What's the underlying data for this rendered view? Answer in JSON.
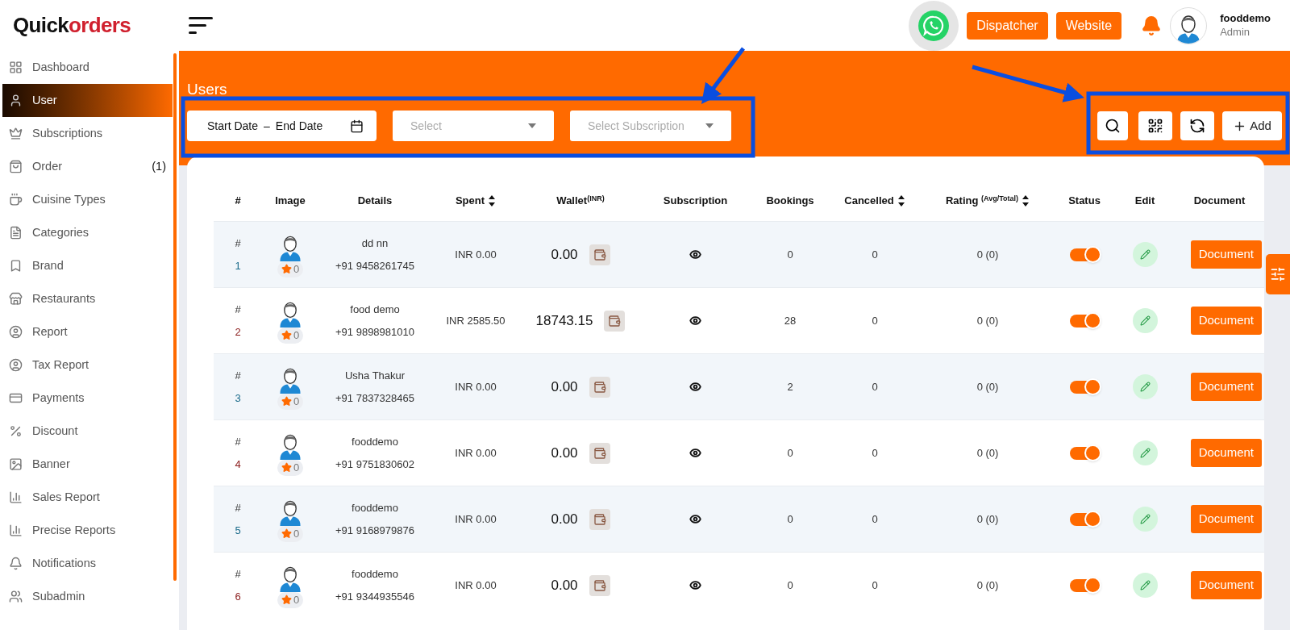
{
  "logo": {
    "part_1": "Quick",
    "part_2": "orders"
  },
  "sidebar": {
    "items": [
      {
        "label": "Dashboard",
        "selected": false
      },
      {
        "label": "User",
        "selected": true
      },
      {
        "label": "Subscriptions",
        "selected": false
      },
      {
        "label": "Order",
        "selected": false,
        "count": "(1)"
      },
      {
        "label": "Cuisine Types",
        "selected": false
      },
      {
        "label": "Categories",
        "selected": false
      },
      {
        "label": "Brand",
        "selected": false
      },
      {
        "label": "Restaurants",
        "selected": false
      },
      {
        "label": "Report",
        "selected": false
      },
      {
        "label": "Tax Report",
        "selected": false
      },
      {
        "label": "Payments",
        "selected": false
      },
      {
        "label": "Discount",
        "selected": false
      },
      {
        "label": "Banner",
        "selected": false
      },
      {
        "label": "Sales Report",
        "selected": false
      },
      {
        "label": "Precise Reports",
        "selected": false
      },
      {
        "label": "Notifications",
        "selected": false
      },
      {
        "label": "Subadmin",
        "selected": false
      }
    ]
  },
  "header": {
    "buttons": [
      "Dispatcher",
      "Website"
    ],
    "user": {
      "name": "fooddemo",
      "role": "Admin"
    }
  },
  "page": {
    "title": "Users",
    "filters": {
      "date_start": "Start Date",
      "date_separator": "–",
      "date_end": "End Date",
      "select_placeholder": "Select",
      "subscription_placeholder": "Select Subscription"
    },
    "add_button": "Add"
  },
  "table": {
    "columns": [
      {
        "label": "#",
        "sortable": false
      },
      {
        "label": "Image",
        "sortable": false
      },
      {
        "label": "Details",
        "sortable": false
      },
      {
        "label": "Spent",
        "sortable": true
      },
      {
        "label": "Wallet$^{(INR)}$",
        "sortable": false
      },
      {
        "label": "Subscription",
        "sortable": false
      },
      {
        "label": "Bookings",
        "sortable": false
      },
      {
        "label": "Cancelled",
        "sortable": true
      },
      {
        "label": "Rating $^{(Avg/Total)}$",
        "sortable": true
      },
      {
        "label": "Status",
        "sortable": false
      },
      {
        "label": "Edit",
        "sortable": false
      },
      {
        "label": "Document",
        "sortable": false
      }
    ],
    "rows": [
      {
        "hash": "#",
        "index": "1",
        "rating_count": "0",
        "name": "dd nn",
        "phone": "+91 9458261745",
        "spent": "INR 0.00",
        "wallet": "0.00",
        "bookings": "0",
        "cancelled": "0",
        "rating": "0 (0)",
        "on": true,
        "document": "Document"
      },
      {
        "hash": "#",
        "index": "2",
        "rating_count": "0",
        "name": "food demo",
        "phone": "+91 9898981010",
        "spent": "INR 2585.50",
        "wallet": "18743.15",
        "bookings": "28",
        "cancelled": "0",
        "rating": "0 (0)",
        "on": true,
        "document": "Document"
      },
      {
        "hash": "#",
        "index": "3",
        "rating_count": "0",
        "name": "Usha Thakur",
        "phone": "+91 7837328465",
        "spent": "INR 0.00",
        "wallet": "0.00",
        "bookings": "2",
        "cancelled": "0",
        "rating": "0 (0)",
        "on": true,
        "document": "Document"
      },
      {
        "hash": "#",
        "index": "4",
        "rating_count": "0",
        "name": "fooddemo",
        "phone": "+91 9751830602",
        "spent": "INR 0.00",
        "wallet": "0.00",
        "bookings": "0",
        "cancelled": "0",
        "rating": "0 (0)",
        "on": true,
        "document": "Document"
      },
      {
        "hash": "#",
        "index": "5",
        "rating_count": "0",
        "name": "fooddemo",
        "phone": "+91 9168979876",
        "spent": "INR 0.00",
        "wallet": "0.00",
        "bookings": "0",
        "cancelled": "0",
        "rating": "0 (0)",
        "on": true,
        "document": "Document"
      },
      {
        "hash": "#",
        "index": "6",
        "rating_count": "0",
        "name": "fooddemo",
        "phone": "+91 9344935546",
        "spent": "INR 0.00",
        "wallet": "0.00",
        "bookings": "0",
        "cancelled": "0",
        "rating": "0 (0)",
        "on": true,
        "document": "Document"
      }
    ]
  }
}
